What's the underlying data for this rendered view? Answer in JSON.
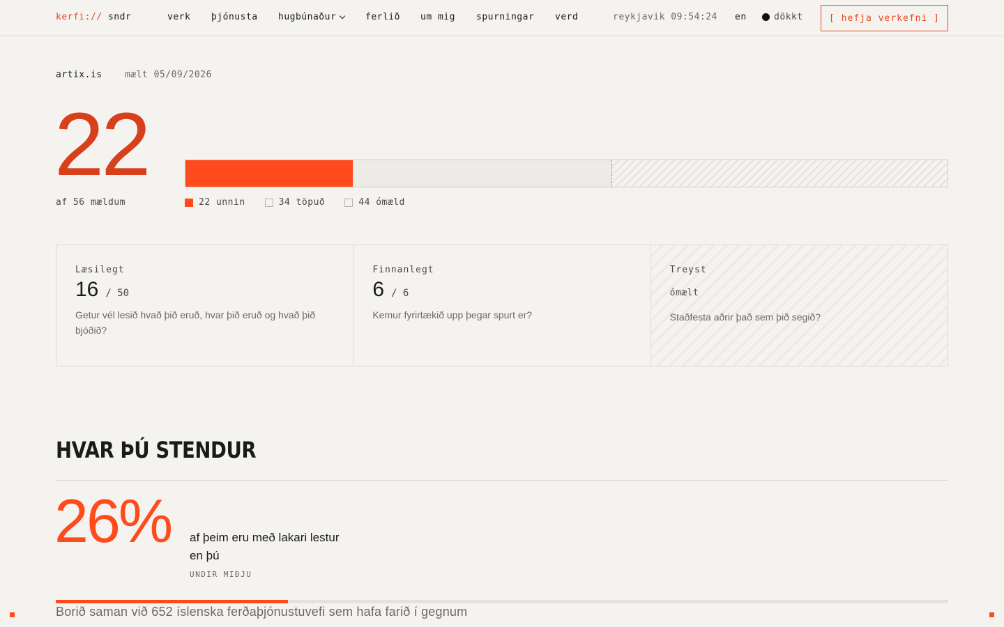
{
  "header": {
    "brand_prefix": "kerfi://",
    "brand_name": "sndr",
    "nav": [
      {
        "label": "verk"
      },
      {
        "label": "þjónusta"
      },
      {
        "label": "hugbúnaður"
      },
      {
        "label": "ferlið"
      },
      {
        "label": "um mig"
      },
      {
        "label": "spurningar"
      },
      {
        "label": "verd"
      }
    ],
    "clock": "reykjavik 09:54:24",
    "lang": "en",
    "theme": "dökkt",
    "cta": "[ hefja verkefni ]"
  },
  "meta": {
    "site": "artix.is",
    "measured": "mælt 05/09/2026"
  },
  "score": {
    "value": "22",
    "subtitle": "af 56 mældum",
    "won": 22,
    "lost": 34,
    "unmeasured": 44,
    "legend": {
      "won": "22 unnin",
      "lost": "34 töpuð",
      "unmeasured": "44 ómæld"
    }
  },
  "cards": [
    {
      "label": "Læsilegt",
      "score": "16",
      "max": "/ 50",
      "question": "Getur vél lesið hvað þið eruð, hvar þið eruð og hvað þið bjóðið?"
    },
    {
      "label": "Finnanlegt",
      "score": "6",
      "max": "/ 6",
      "question": "Kemur fyrirtækið upp þegar spurt er?"
    },
    {
      "label": "Treyst",
      "status": "ómælt",
      "question": "Staðfesta aðrir það sem þið segið?"
    }
  ],
  "standing": {
    "title": "HVAR ÞÚ STENDUR",
    "percent": "26%",
    "percent_value": 26,
    "description": "af þeim eru með lakari lestur en þú",
    "tag": "UNDIR MIÐJU",
    "compare": "Borið saman við 652 íslenska ferðaþjónustuvefi sem hafa farið í gegnum"
  },
  "colors": {
    "accent": "#ff4a1c",
    "accent_dark": "#d8401c",
    "background": "#f4f3f0"
  }
}
